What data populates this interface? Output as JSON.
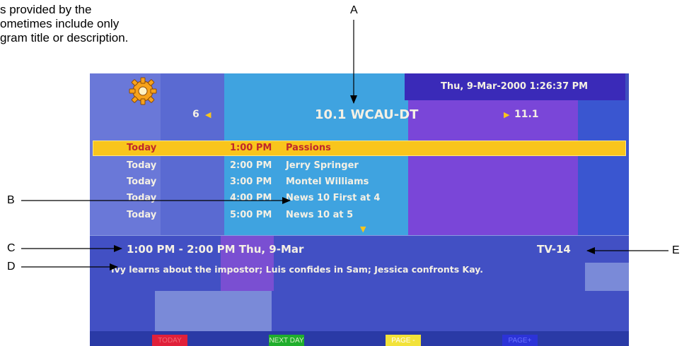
{
  "doc_text": [
    "s provided by the",
    "ometimes include only",
    "gram title or description."
  ],
  "callouts": {
    "a": "A",
    "b": "B",
    "c": "C",
    "d": "D",
    "e": "E"
  },
  "guide": {
    "settings_icon": "gear-icon",
    "datetime": "Thu, 9-Mar-2000 1:26:37 PM",
    "prev_channel": "6",
    "prev_arrow": "◀",
    "current_channel": "10.1 WCAU-DT",
    "next_arrow": "▶",
    "next_channel": "11.1",
    "listings": [
      {
        "day": "Today",
        "time": "1:00 PM",
        "title": "Passions",
        "selected": true
      },
      {
        "day": "Today",
        "time": "2:00 PM",
        "title": "Jerry Springer",
        "selected": false
      },
      {
        "day": "Today",
        "time": "3:00 PM",
        "title": "Montel Williams",
        "selected": false
      },
      {
        "day": "Today",
        "time": "4:00 PM",
        "title": "News 10 First at 4",
        "selected": false
      },
      {
        "day": "Today",
        "time": "5:00 PM",
        "title": "News 10 at 5",
        "selected": false
      }
    ],
    "scroll_down_indicator": "▼",
    "detail_time": "1:00 PM - 2:00 PM Thu, 9-Mar",
    "rating": "TV-14",
    "description": "Ivy learns about the impostor; Luis confides in Sam; Jessica confronts Kay.",
    "buttons": {
      "today": "TODAY",
      "next_day": "NEXT DAY",
      "page_up": "PAGE -",
      "page_down": "PAGE+"
    },
    "colors": {
      "highlight": "#f9c51c",
      "today_button": "#e0203a",
      "next_day_button": "#1fae2c",
      "page_up_button": "#f2e23a",
      "page_down_button": "#2c33d8"
    }
  }
}
